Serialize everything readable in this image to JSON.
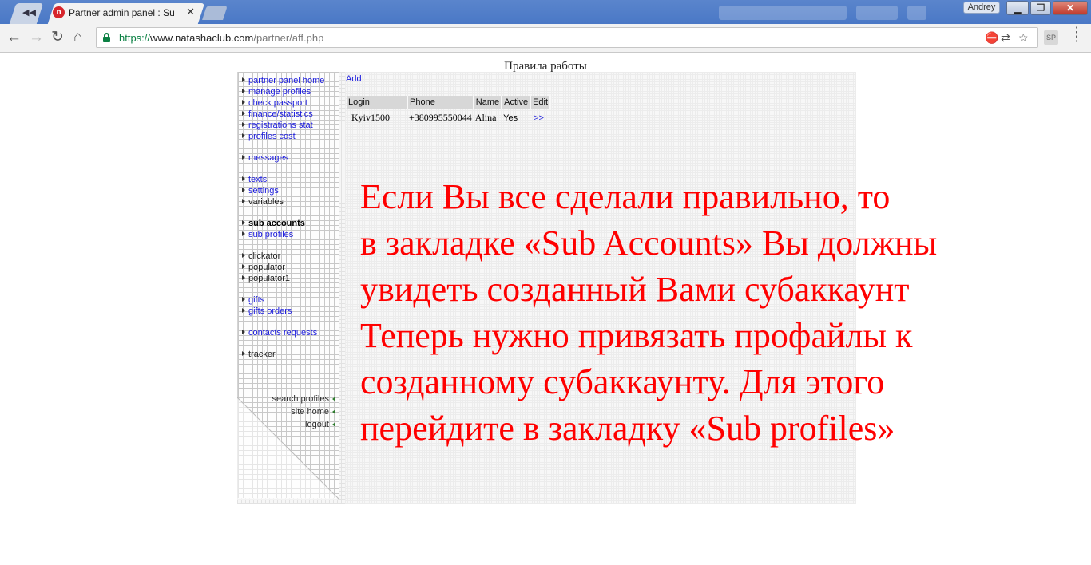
{
  "browser": {
    "tab_title": "Partner admin panel : Sub",
    "favicon_letter": "n",
    "user_name": "Andrey",
    "url_scheme": "https://",
    "url_host": "www.natashaclub.com",
    "url_path": "/partner/aff.php",
    "extension_label": "SP"
  },
  "page": {
    "heading": "Правила работы"
  },
  "sidebar": {
    "groups": [
      [
        "partner panel home",
        "manage profiles",
        "check passport",
        "finance/statistics",
        "registrations stat",
        "profiles cost"
      ],
      [
        "messages"
      ],
      [
        "texts",
        "settings",
        "variables"
      ],
      [
        "sub accounts",
        "sub profiles"
      ],
      [
        "clickator",
        "populator",
        "populator1"
      ],
      [
        "gifts",
        "gifts orders"
      ],
      [
        "contacts requests"
      ],
      [
        "tracker"
      ]
    ],
    "bottom_links": [
      "search profiles",
      "site home",
      "logout"
    ]
  },
  "main": {
    "add_label": "Add",
    "table": {
      "headers": [
        "Login",
        "Phone",
        "Name",
        "Active",
        "Edit"
      ],
      "rows": [
        {
          "login": "Kyiv1500",
          "phone": "+380995550044",
          "name": "Alina",
          "active": "Yes",
          "edit": ">>"
        }
      ]
    }
  },
  "instruction": {
    "lines": [
      "Если Вы все сделали правильно, то",
      "в закладке «Sub Accounts» Вы должны",
      "увидеть созданный Вами субаккаунт",
      "Теперь нужно привязать профайлы к",
      "созданному субаккаунту. Для этого",
      "перейдите в закладку «Sub profiles»"
    ],
    "color": "#ff0000"
  }
}
